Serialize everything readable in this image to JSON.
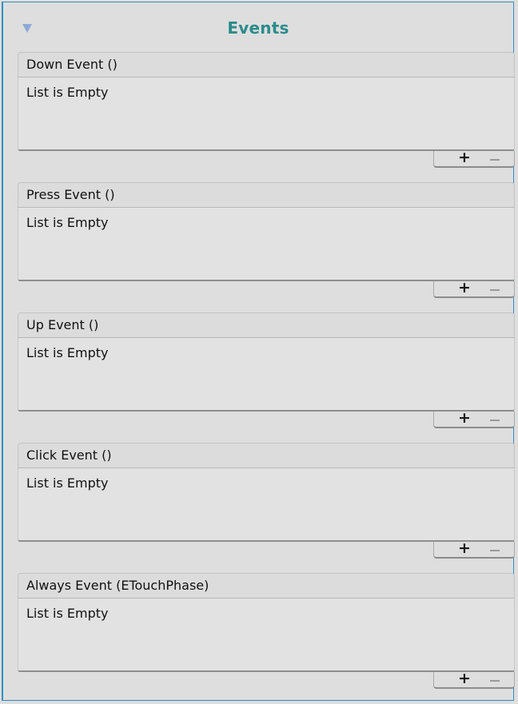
{
  "header": {
    "title": "Events",
    "foldout_icon": "triangle-down-icon"
  },
  "events": [
    {
      "title": "Down Event ()",
      "list_text": "List is Empty",
      "add": "+",
      "remove": "-"
    },
    {
      "title": "Press Event ()",
      "list_text": "List is Empty",
      "add": "+",
      "remove": "-"
    },
    {
      "title": "Up Event ()",
      "list_text": "List is Empty",
      "add": "+",
      "remove": "-"
    },
    {
      "title": "Click Event ()",
      "list_text": "List is Empty",
      "add": "+",
      "remove": "-"
    },
    {
      "title": "Always Event (ETouchPhase)",
      "list_text": "List is Empty",
      "add": "+",
      "remove": "-"
    }
  ],
  "colors": {
    "title": "#2a8c8c",
    "panel_border": "#2f8fc4",
    "foldout_icon": "#8ea9d6"
  }
}
